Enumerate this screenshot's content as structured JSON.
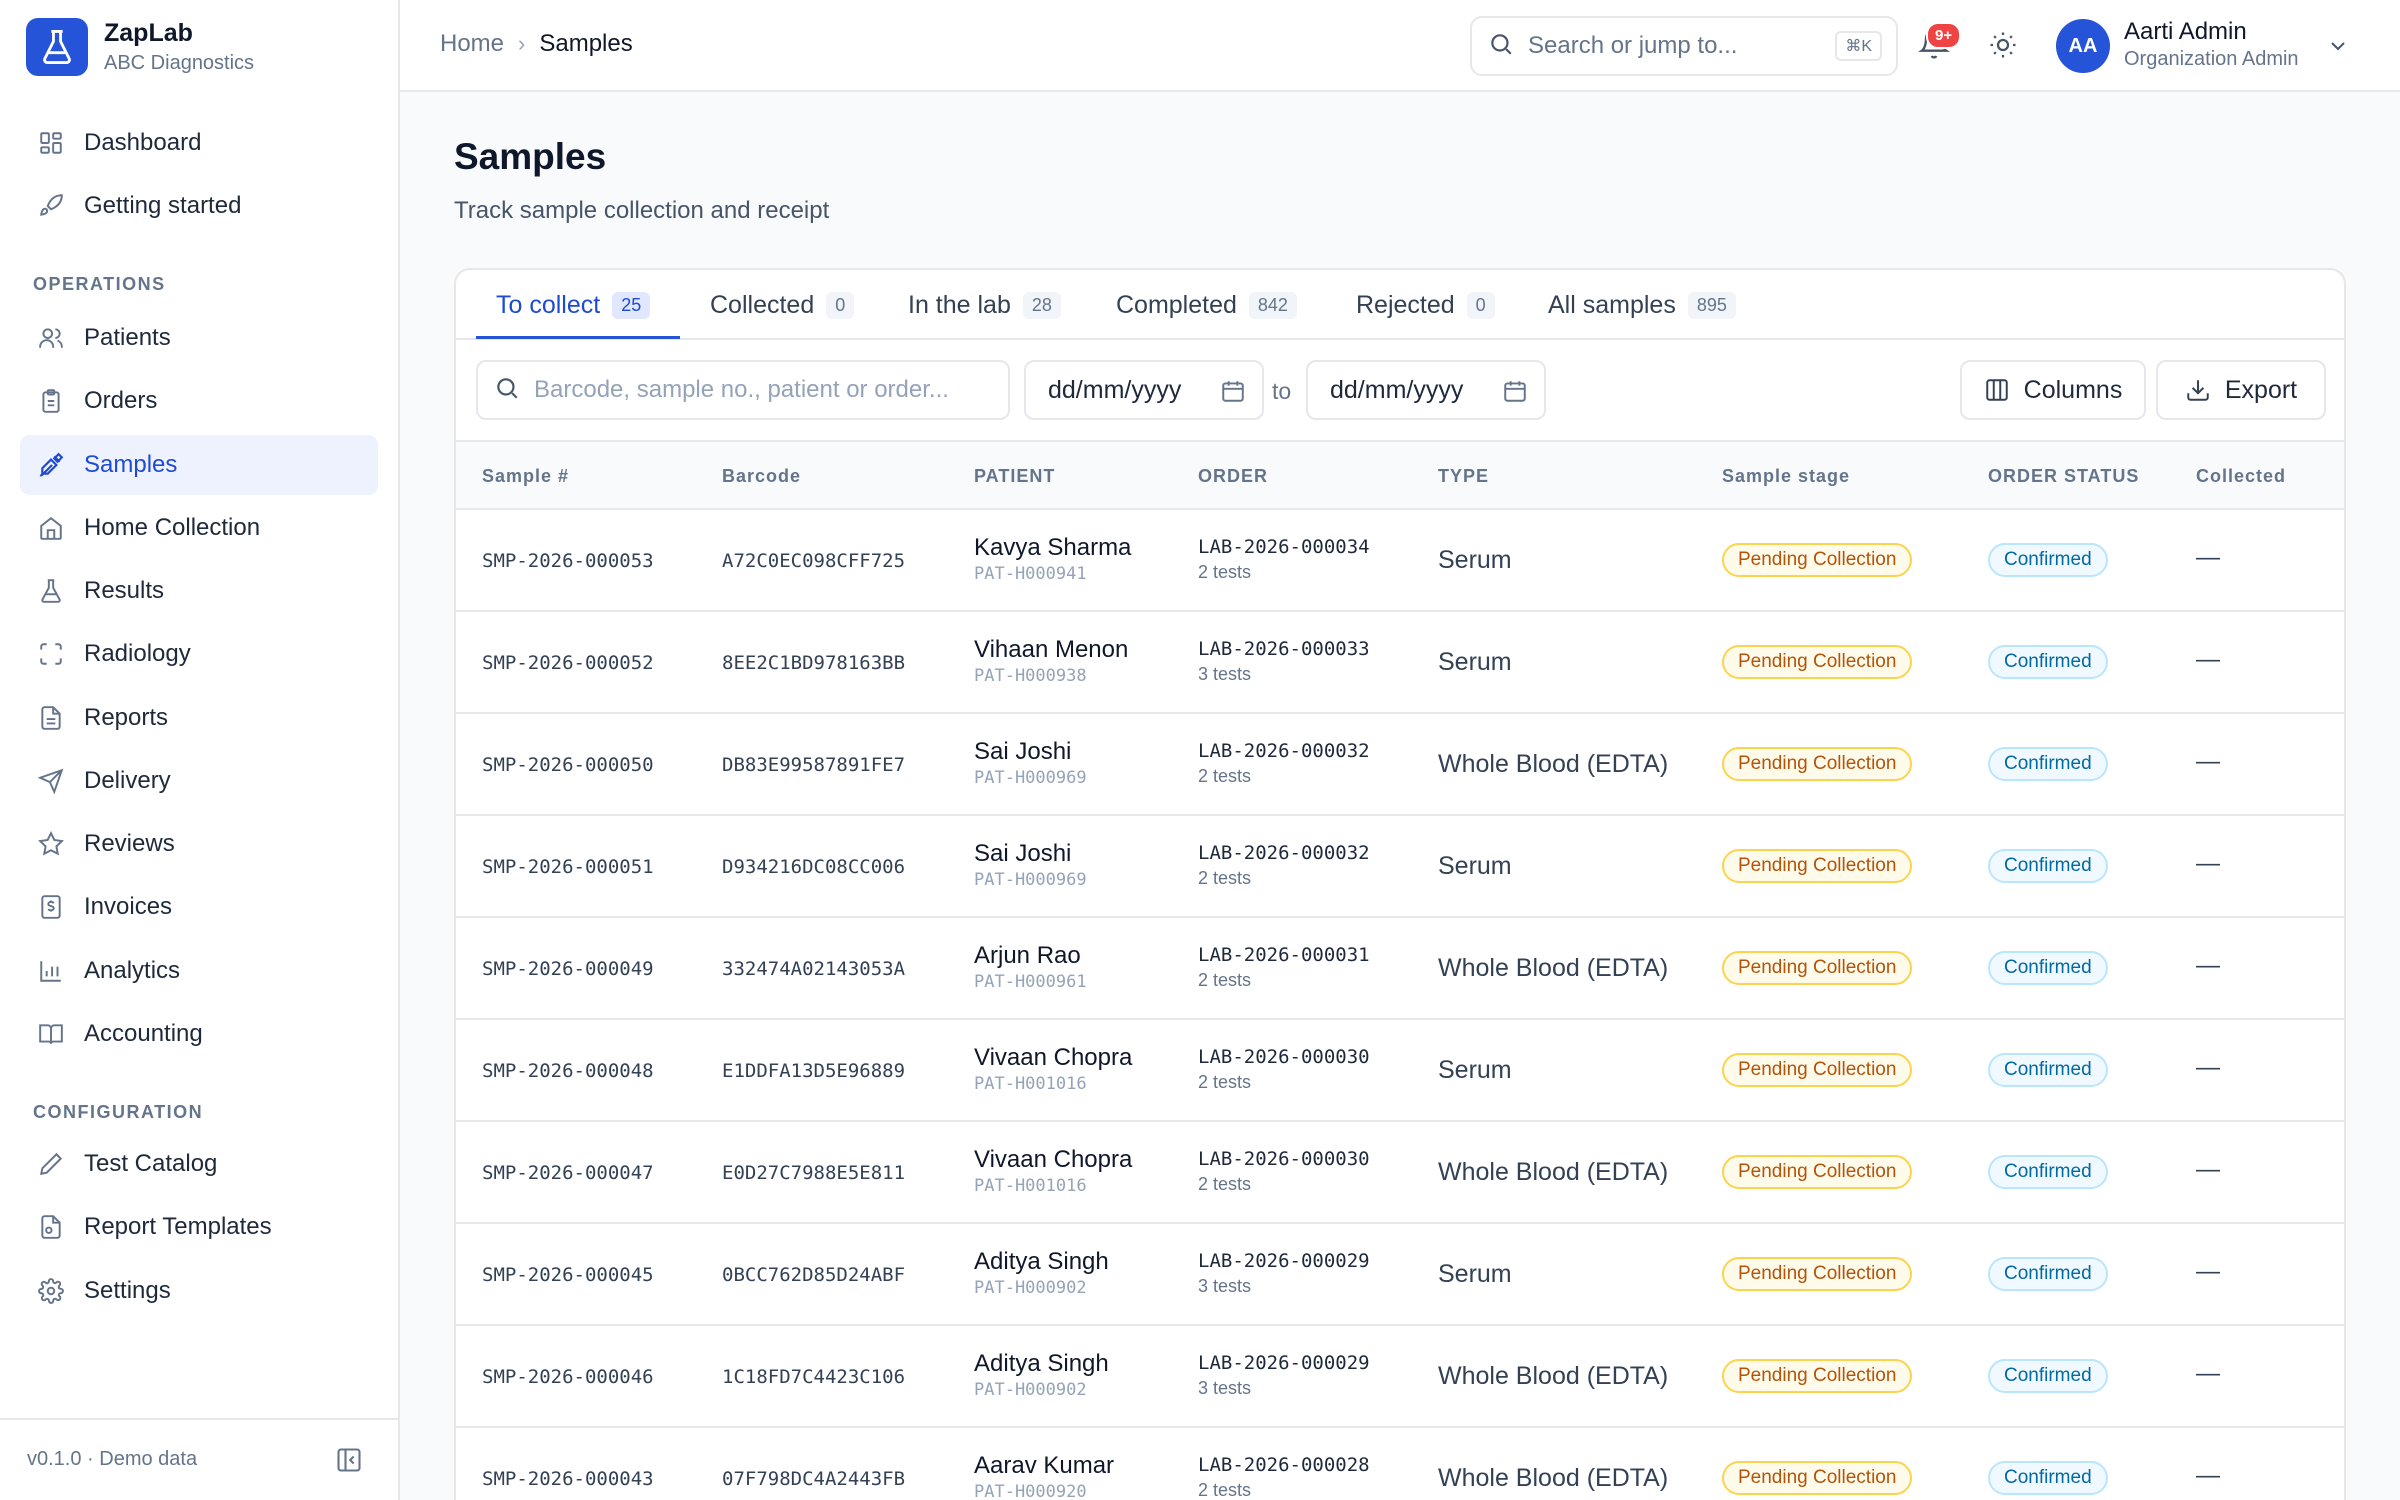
{
  "brand": {
    "name": "ZapLab",
    "org": "ABC Diagnostics"
  },
  "sidebar": {
    "top_items": [
      {
        "label": "Dashboard",
        "icon": "dashboard-icon"
      },
      {
        "label": "Getting started",
        "icon": "rocket-icon"
      }
    ],
    "operations_label": "OPERATIONS",
    "operations": [
      {
        "label": "Patients",
        "icon": "users-icon"
      },
      {
        "label": "Orders",
        "icon": "clipboard-icon"
      },
      {
        "label": "Samples",
        "icon": "pipette-icon",
        "active": true
      },
      {
        "label": "Home Collection",
        "icon": "home-icon"
      },
      {
        "label": "Results",
        "icon": "flask-icon"
      },
      {
        "label": "Radiology",
        "icon": "scan-icon"
      },
      {
        "label": "Reports",
        "icon": "file-text-icon"
      },
      {
        "label": "Delivery",
        "icon": "send-icon"
      },
      {
        "label": "Reviews",
        "icon": "star-icon"
      },
      {
        "label": "Invoices",
        "icon": "receipt-icon"
      },
      {
        "label": "Analytics",
        "icon": "bar-chart-icon"
      },
      {
        "label": "Accounting",
        "icon": "book-icon"
      }
    ],
    "configuration_label": "CONFIGURATION",
    "configuration": [
      {
        "label": "Test Catalog",
        "icon": "pencil-icon"
      },
      {
        "label": "Report Templates",
        "icon": "file-settings-icon"
      },
      {
        "label": "Settings",
        "icon": "gear-icon"
      }
    ],
    "version": "v0.1.0 · Demo data"
  },
  "header": {
    "breadcrumb_home": "Home",
    "breadcrumb_current": "Samples",
    "search_placeholder": "Search or jump to...",
    "search_shortcut": "⌘K",
    "notification_count": "9+",
    "user_initials": "AA",
    "user_name": "Aarti Admin",
    "user_role": "Organization Admin"
  },
  "page": {
    "title": "Samples",
    "subtitle": "Track sample collection and receipt"
  },
  "tabs": [
    {
      "label": "To collect",
      "count": "25",
      "active": true
    },
    {
      "label": "Collected",
      "count": "0"
    },
    {
      "label": "In the lab",
      "count": "28"
    },
    {
      "label": "Completed",
      "count": "842"
    },
    {
      "label": "Rejected",
      "count": "0"
    },
    {
      "label": "All samples",
      "count": "895"
    }
  ],
  "filters": {
    "search_placeholder": "Barcode, sample no., patient or order...",
    "date_from_placeholder": "dd/mm/yyyy",
    "date_to_placeholder": "dd/mm/yyyy",
    "to_label": "to",
    "columns_label": "Columns",
    "export_label": "Export"
  },
  "table": {
    "headers": {
      "sample": "Sample #",
      "barcode": "Barcode",
      "patient": "PATIENT",
      "order": "ORDER",
      "type": "TYPE",
      "stage": "Sample stage",
      "status": "ORDER STATUS",
      "collected": "Collected"
    },
    "rows": [
      {
        "sample": "SMP-2026-000053",
        "barcode": "A72C0EC098CFF725",
        "patient": "Kavya Sharma",
        "patient_id": "PAT-H000941",
        "order": "LAB-2026-000034",
        "tests": "2 tests",
        "type": "Serum",
        "stage": "Pending Collection",
        "status": "Confirmed",
        "collected": "—"
      },
      {
        "sample": "SMP-2026-000052",
        "barcode": "8EE2C1BD978163BB",
        "patient": "Vihaan Menon",
        "patient_id": "PAT-H000938",
        "order": "LAB-2026-000033",
        "tests": "3 tests",
        "type": "Serum",
        "stage": "Pending Collection",
        "status": "Confirmed",
        "collected": "—"
      },
      {
        "sample": "SMP-2026-000050",
        "barcode": "DB83E99587891FE7",
        "patient": "Sai Joshi",
        "patient_id": "PAT-H000969",
        "order": "LAB-2026-000032",
        "tests": "2 tests",
        "type": "Whole Blood (EDTA)",
        "stage": "Pending Collection",
        "status": "Confirmed",
        "collected": "—"
      },
      {
        "sample": "SMP-2026-000051",
        "barcode": "D934216DC08CC006",
        "patient": "Sai Joshi",
        "patient_id": "PAT-H000969",
        "order": "LAB-2026-000032",
        "tests": "2 tests",
        "type": "Serum",
        "stage": "Pending Collection",
        "status": "Confirmed",
        "collected": "—"
      },
      {
        "sample": "SMP-2026-000049",
        "barcode": "332474A02143053A",
        "patient": "Arjun Rao",
        "patient_id": "PAT-H000961",
        "order": "LAB-2026-000031",
        "tests": "2 tests",
        "type": "Whole Blood (EDTA)",
        "stage": "Pending Collection",
        "status": "Confirmed",
        "collected": "—"
      },
      {
        "sample": "SMP-2026-000048",
        "barcode": "E1DDFA13D5E96889",
        "patient": "Vivaan Chopra",
        "patient_id": "PAT-H001016",
        "order": "LAB-2026-000030",
        "tests": "2 tests",
        "type": "Serum",
        "stage": "Pending Collection",
        "status": "Confirmed",
        "collected": "—"
      },
      {
        "sample": "SMP-2026-000047",
        "barcode": "E0D27C7988E5E811",
        "patient": "Vivaan Chopra",
        "patient_id": "PAT-H001016",
        "order": "LAB-2026-000030",
        "tests": "2 tests",
        "type": "Whole Blood (EDTA)",
        "stage": "Pending Collection",
        "status": "Confirmed",
        "collected": "—"
      },
      {
        "sample": "SMP-2026-000045",
        "barcode": "0BCC762D85D24ABF",
        "patient": "Aditya Singh",
        "patient_id": "PAT-H000902",
        "order": "LAB-2026-000029",
        "tests": "3 tests",
        "type": "Serum",
        "stage": "Pending Collection",
        "status": "Confirmed",
        "collected": "—"
      },
      {
        "sample": "SMP-2026-000046",
        "barcode": "1C18FD7C4423C106",
        "patient": "Aditya Singh",
        "patient_id": "PAT-H000902",
        "order": "LAB-2026-000029",
        "tests": "3 tests",
        "type": "Whole Blood (EDTA)",
        "stage": "Pending Collection",
        "status": "Confirmed",
        "collected": "—"
      },
      {
        "sample": "SMP-2026-000043",
        "barcode": "07F798DC4A2443FB",
        "patient": "Aarav Kumar",
        "patient_id": "PAT-H000920",
        "order": "LAB-2026-000028",
        "tests": "2 tests",
        "type": "Whole Blood (EDTA)",
        "stage": "Pending Collection",
        "status": "Confirmed",
        "collected": "—"
      }
    ]
  },
  "colors": {
    "accent": "#2554d9",
    "stage_pending": "#b45309",
    "status_confirmed": "#0369a1",
    "notification": "#ef4444"
  }
}
